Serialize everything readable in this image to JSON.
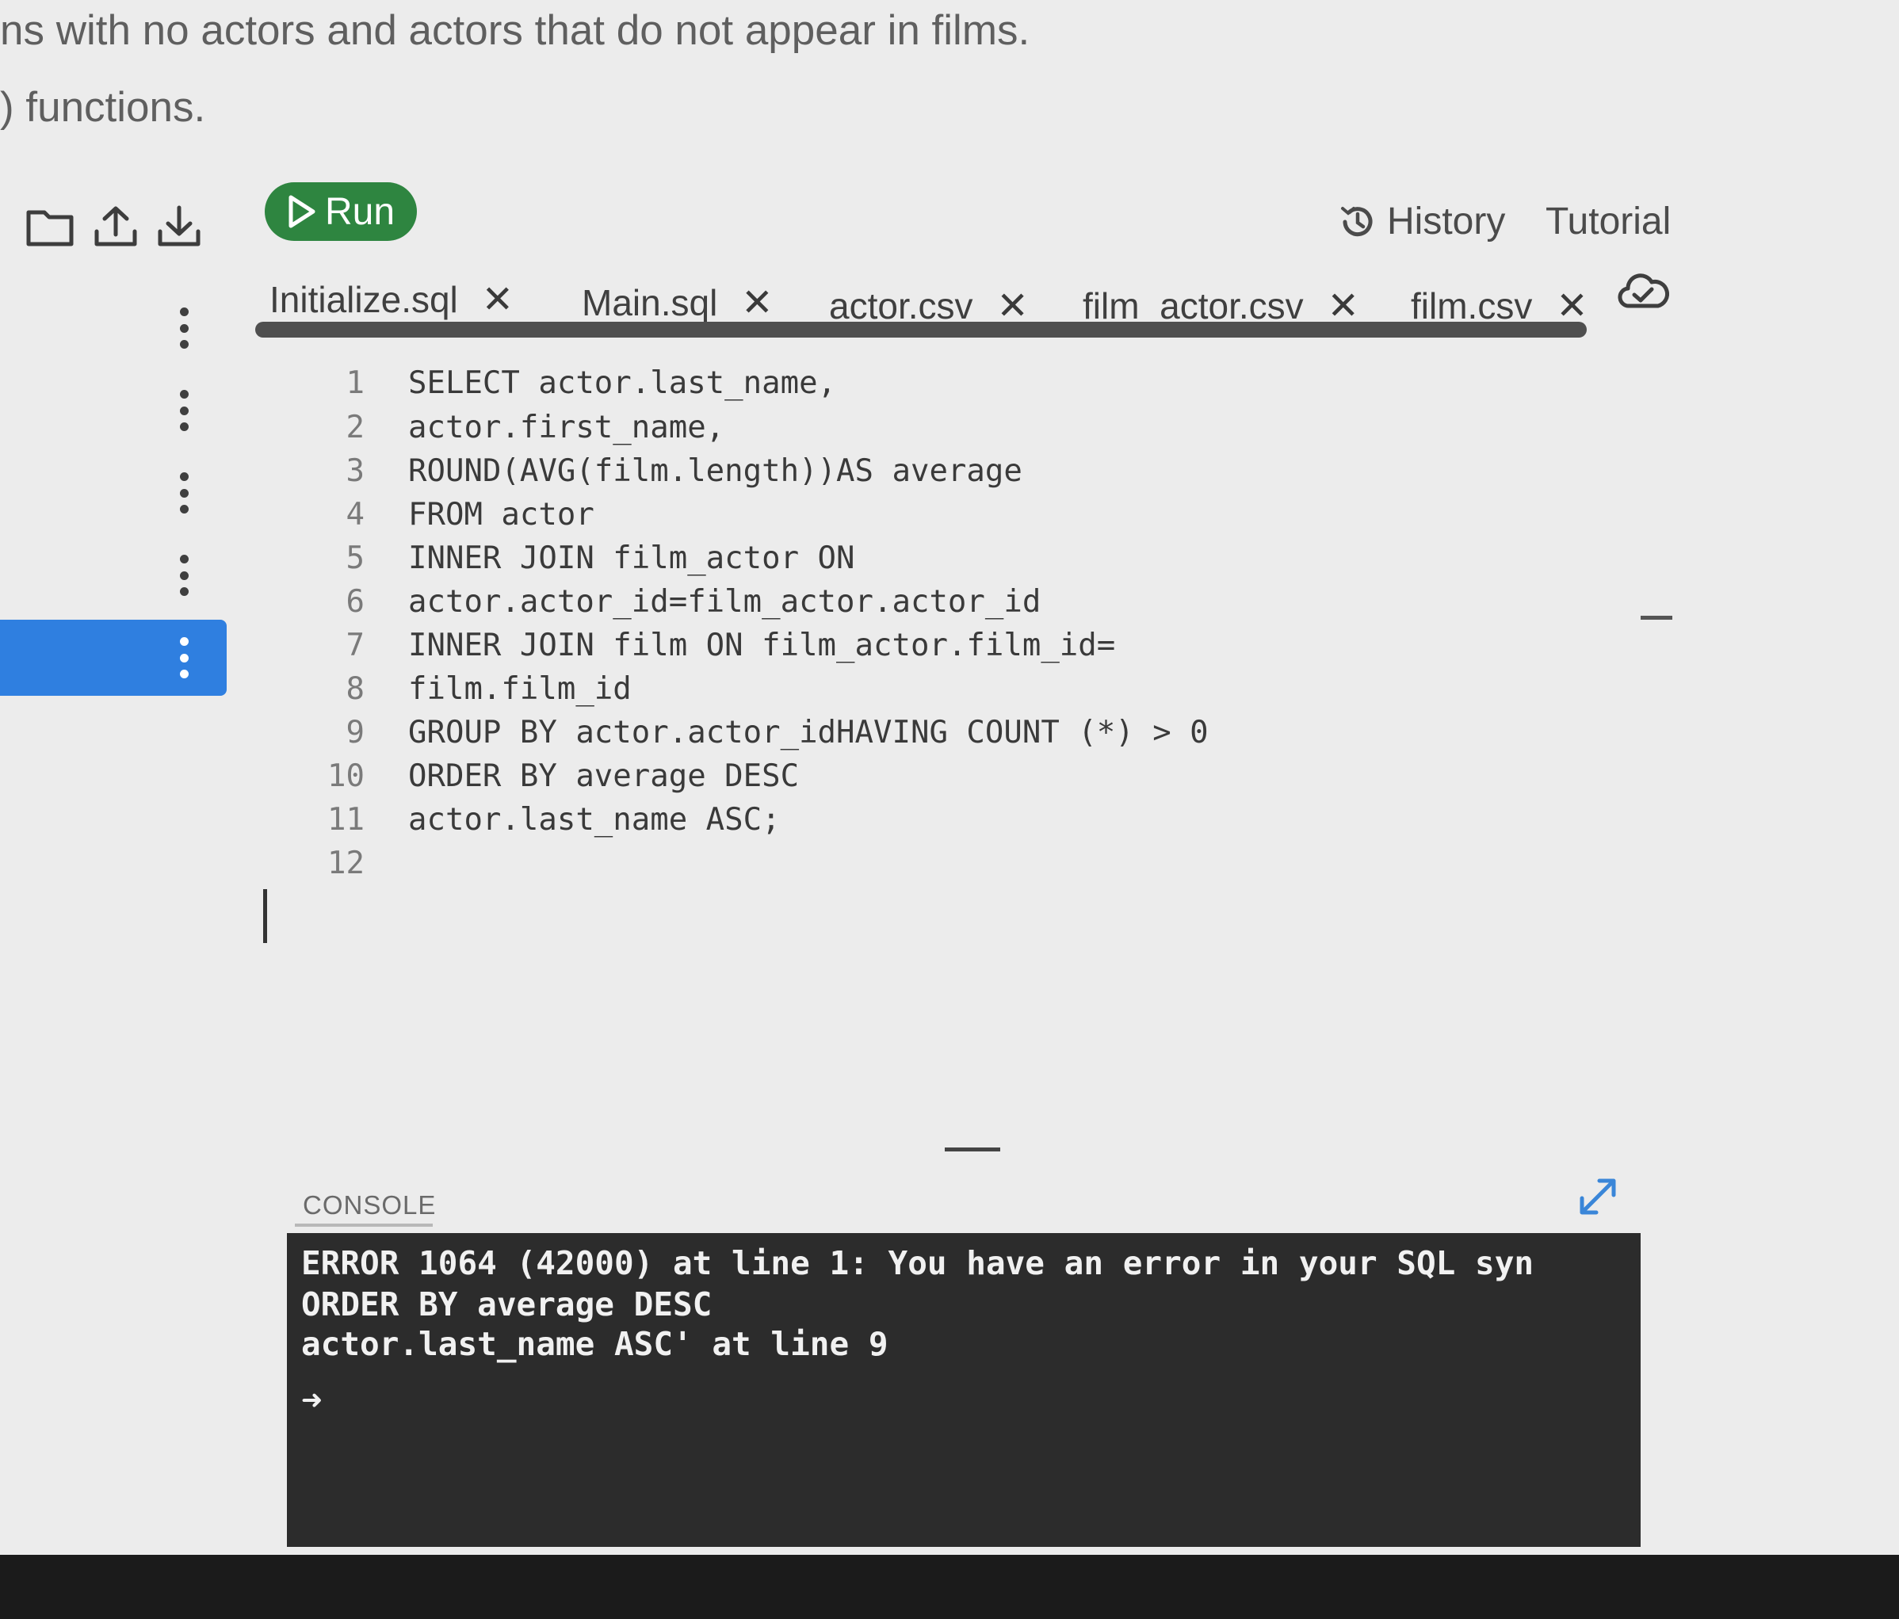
{
  "instructions": {
    "line1": "ns with no actors and actors that do not appear in films.",
    "line2": ") functions."
  },
  "toolbar": {
    "icons": [
      "folder-icon",
      "upload-icon",
      "download-icon"
    ],
    "run_label": "Run",
    "history_label": "History",
    "tutorial_label": "Tutorial"
  },
  "tabs": [
    {
      "label": "Initialize.sql",
      "close": "✕"
    },
    {
      "label": "Main.sql",
      "close": "✕"
    },
    {
      "label": "actor.csv",
      "close": "✕"
    },
    {
      "label": "film_actor.csv",
      "close": "✕"
    },
    {
      "label": "film.csv",
      "close": "✕"
    }
  ],
  "editor": {
    "lines": [
      {
        "num": "1",
        "text": "SELECT actor.last_name,"
      },
      {
        "num": "2",
        "text": "actor.first_name,"
      },
      {
        "num": "3",
        "text": "ROUND(AVG(film.length))AS average"
      },
      {
        "num": "4",
        "text": "FROM actor"
      },
      {
        "num": "5",
        "text": "INNER JOIN film_actor ON"
      },
      {
        "num": "6",
        "text": "actor.actor_id=film_actor.actor_id"
      },
      {
        "num": "7",
        "text": "INNER JOIN film ON film_actor.film_id="
      },
      {
        "num": "8",
        "text": "film.film_id"
      },
      {
        "num": "9",
        "text": "GROUP BY actor.actor_idHAVING COUNT (*) > 0"
      },
      {
        "num": "10",
        "text": "ORDER BY average DESC"
      },
      {
        "num": "11",
        "text": "actor.last_name ASC;"
      },
      {
        "num": "12",
        "text": ""
      }
    ]
  },
  "console": {
    "label": "CONSOLE",
    "lines": [
      "ERROR 1064 (42000) at line 1: You have an error in your SQL syn",
      "ORDER BY average DESC",
      "actor.last_name ASC' at line 9"
    ],
    "prompt": "➜"
  },
  "colors": {
    "run_button": "#2e8540",
    "active_file": "#2f7fe0",
    "console_bg": "#2c2c2c"
  }
}
